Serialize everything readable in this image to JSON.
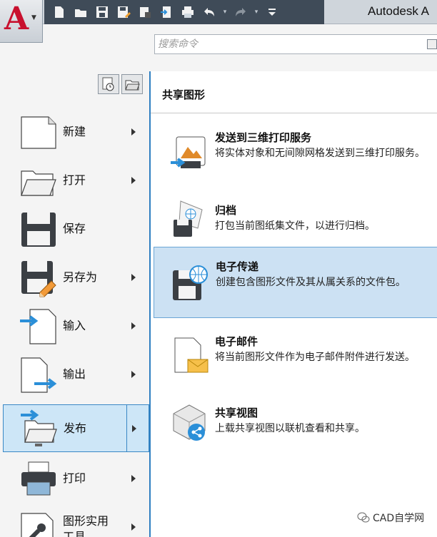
{
  "window": {
    "title": "Autodesk A"
  },
  "app_button": {
    "logo": "A"
  },
  "search": {
    "placeholder": "搜索命令"
  },
  "left_menu": {
    "items": [
      {
        "label": "新建"
      },
      {
        "label": "打开"
      },
      {
        "label": "保存"
      },
      {
        "label": "另存为"
      },
      {
        "label": "输入"
      },
      {
        "label": "输出"
      },
      {
        "label": "发布"
      },
      {
        "label": "打印"
      },
      {
        "label_line1": "图形实用",
        "label_line2": "工具"
      }
    ]
  },
  "panel": {
    "title": "共享图形",
    "items": [
      {
        "title": "发送到三维打印服务",
        "desc": "将实体对象和无间隙网格发送到三维打印服务。"
      },
      {
        "title": "归档",
        "desc": "打包当前图纸集文件，以进行归档。"
      },
      {
        "title": "电子传递",
        "desc": "创建包含图形文件及其从属关系的文件包。"
      },
      {
        "title": "电子邮件",
        "desc": "将当前图形文件作为电子邮件附件进行发送。"
      },
      {
        "title": "共享视图",
        "desc": "上载共享视图以联机查看和共享。"
      }
    ]
  },
  "footer": {
    "brand": "CAD自学网"
  },
  "colors": {
    "accent": "#2f7fc1",
    "selection": "#cde6f7",
    "qat_bg": "#3f4b58",
    "logo_red": "#c8102e"
  }
}
